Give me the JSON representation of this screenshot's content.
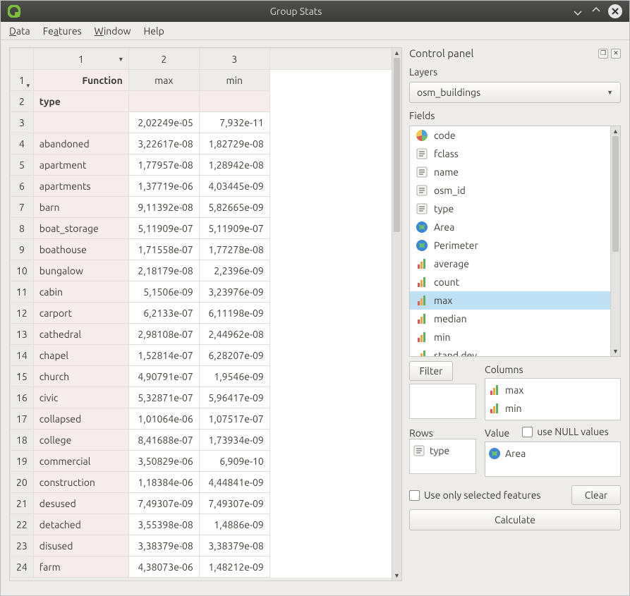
{
  "window": {
    "title": "Group Stats"
  },
  "menu": {
    "data": "Data",
    "features": "Features",
    "window": "Window",
    "help": "Help"
  },
  "grid": {
    "col_heads": [
      "1",
      "2",
      "3"
    ],
    "row_head_for_function": "1",
    "function_label": "Function",
    "stat_headers": {
      "max": "max",
      "min": "min"
    },
    "type_row_head": "2",
    "type_label": "type",
    "rows": [
      {
        "n": "3",
        "name": "",
        "max": "2,02249e-05",
        "min": "7,932e-11"
      },
      {
        "n": "4",
        "name": "abandoned",
        "max": "3,22617e-08",
        "min": "1,82729e-08"
      },
      {
        "n": "5",
        "name": "apartment",
        "max": "1,77957e-08",
        "min": "1,28942e-08"
      },
      {
        "n": "6",
        "name": "apartments",
        "max": "1,37719e-06",
        "min": "4,03445e-09"
      },
      {
        "n": "7",
        "name": "barn",
        "max": "9,11392e-08",
        "min": "5,82665e-09"
      },
      {
        "n": "8",
        "name": "boat_storage",
        "max": "5,11909e-07",
        "min": "5,11909e-07"
      },
      {
        "n": "9",
        "name": "boathouse",
        "max": "1,71558e-07",
        "min": "1,77278e-08"
      },
      {
        "n": "10",
        "name": "bungalow",
        "max": "2,18179e-08",
        "min": "2,2396e-09"
      },
      {
        "n": "11",
        "name": "cabin",
        "max": "5,1506e-09",
        "min": "3,23976e-09"
      },
      {
        "n": "12",
        "name": "carport",
        "max": "6,2133e-07",
        "min": "6,11198e-09"
      },
      {
        "n": "13",
        "name": "cathedral",
        "max": "2,98108e-07",
        "min": "2,44962e-08"
      },
      {
        "n": "14",
        "name": "chapel",
        "max": "1,52814e-07",
        "min": "6,28207e-09"
      },
      {
        "n": "15",
        "name": "church",
        "max": "4,90791e-07",
        "min": "1,9546e-09"
      },
      {
        "n": "16",
        "name": "civic",
        "max": "5,32871e-07",
        "min": "5,96417e-09"
      },
      {
        "n": "17",
        "name": "collapsed",
        "max": "1,01064e-06",
        "min": "1,07517e-07"
      },
      {
        "n": "18",
        "name": "college",
        "max": "8,41688e-07",
        "min": "1,73934e-09"
      },
      {
        "n": "19",
        "name": "commercial",
        "max": "3,50829e-06",
        "min": "6,909e-10"
      },
      {
        "n": "20",
        "name": "construction",
        "max": "1,18384e-06",
        "min": "4,44841e-09"
      },
      {
        "n": "21",
        "name": "desused",
        "max": "7,49307e-09",
        "min": "7,49307e-09"
      },
      {
        "n": "22",
        "name": "detached",
        "max": "3,55398e-08",
        "min": "1,4886e-09"
      },
      {
        "n": "23",
        "name": "disused",
        "max": "3,38379e-08",
        "min": "3,38379e-08"
      },
      {
        "n": "24",
        "name": "farm",
        "max": "4,38073e-06",
        "min": "1,48212e-09"
      }
    ]
  },
  "panel": {
    "title": "Control panel",
    "layers_label": "Layers",
    "layers_value": "osm_buildings",
    "fields_label": "Fields",
    "fields": [
      {
        "icon": "pie",
        "label": "code"
      },
      {
        "icon": "text",
        "label": "fclass"
      },
      {
        "icon": "text",
        "label": "name"
      },
      {
        "icon": "text",
        "label": "osm_id"
      },
      {
        "icon": "text",
        "label": "type"
      },
      {
        "icon": "globe",
        "label": "Area"
      },
      {
        "icon": "globe",
        "label": "Perimeter"
      },
      {
        "icon": "bars",
        "label": "average"
      },
      {
        "icon": "bars",
        "label": "count"
      },
      {
        "icon": "bars",
        "label": "max",
        "selected": true
      },
      {
        "icon": "bars",
        "label": "median"
      },
      {
        "icon": "bars",
        "label": "min"
      },
      {
        "icon": "bars",
        "label": "stand.dev."
      }
    ],
    "filter_btn": "Filter",
    "columns_label": "Columns",
    "columns_items": [
      {
        "icon": "bars",
        "label": "max"
      },
      {
        "icon": "bars",
        "label": "min"
      }
    ],
    "rows_label": "Rows",
    "rows_items": [
      {
        "icon": "text",
        "label": "type"
      }
    ],
    "value_label": "Value",
    "use_null_label": "use NULL values",
    "value_items": [
      {
        "icon": "globe",
        "label": "Area"
      }
    ],
    "use_only_selected": "Use only selected features",
    "clear_btn": "Clear",
    "calculate_btn": "Calculate"
  }
}
